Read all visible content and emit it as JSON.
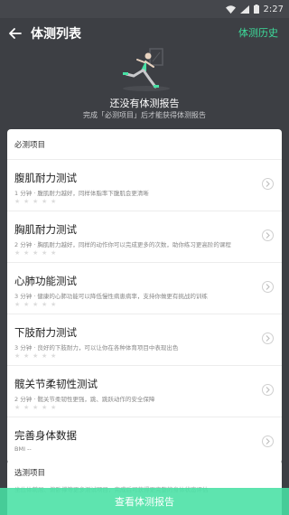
{
  "status_bar": {
    "time": "2:27"
  },
  "header": {
    "title": "体测列表",
    "history_label": "体测历史"
  },
  "hero": {
    "title": "还没有体测报告",
    "subtitle": "完成「必测项目」后才能获得体测报告"
  },
  "required": {
    "section_label": "必测项目",
    "items": [
      {
        "title": "腹肌耐力测试",
        "desc": "1 分钟 · 腹肌耐力越好，同样体脂率下腹肌会更清晰"
      },
      {
        "title": "胸肌耐力测试",
        "desc": "2 分钟 · 胸肌耐力越好，同样的动作你可以完成更多的次数，助你练习更高阶的课程"
      },
      {
        "title": "心肺功能测试",
        "desc": "3 分钟 · 健康的心肺功能可以降低慢性病患病率，支持你做更有挑战的训练"
      },
      {
        "title": "下肢耐力测试",
        "desc": "3 分钟 · 良好的下肢耐力，可以让你在各种体育项目中表现出色"
      },
      {
        "title": "髋关节柔韧性测试",
        "desc": "2 分钟 · 髋关节柔韧性更强，跳、跳跃动作的安全保障"
      },
      {
        "title": "完善身体数据",
        "desc": "BMI --"
      }
    ]
  },
  "optional": {
    "section_label": "选测项目",
    "desc": "坐位体前屈、俯卧撑等更多测试项目，完成后可获得更完整的身体状态评估"
  },
  "bottom_button": {
    "label": "查看体测报告"
  },
  "colors": {
    "accent": "#3ddc9b",
    "background": "#3d3f44",
    "button": "#48e0a4"
  },
  "icons": {
    "back": "arrow-left-icon",
    "chevron": "chevron-right-icon",
    "star": "star-icon",
    "wifi": "wifi-icon",
    "signal": "signal-icon",
    "battery": "battery-icon"
  }
}
